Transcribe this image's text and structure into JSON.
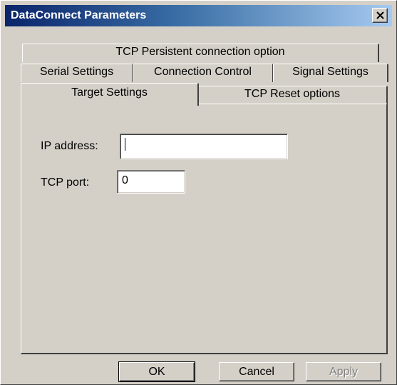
{
  "window": {
    "title": "DataConnect Parameters",
    "close_icon": "close-x-icon"
  },
  "tabs": {
    "row1": [
      {
        "label": "TCP Persistent connection option"
      }
    ],
    "row2": [
      {
        "label": "Serial Settings"
      },
      {
        "label": "Connection Control"
      },
      {
        "label": "Signal Settings"
      }
    ],
    "row3": [
      {
        "label": "Target Settings",
        "selected": true
      },
      {
        "label": "TCP Reset options"
      }
    ]
  },
  "form": {
    "ip_label": "IP address:",
    "ip_value": "",
    "port_label": "TCP port:",
    "port_value": "0"
  },
  "buttons": {
    "ok": "OK",
    "cancel": "Cancel",
    "apply": "Apply"
  },
  "colors": {
    "face": "#d4d0c8",
    "title_start": "#0a246a",
    "title_end": "#a6caf0"
  }
}
